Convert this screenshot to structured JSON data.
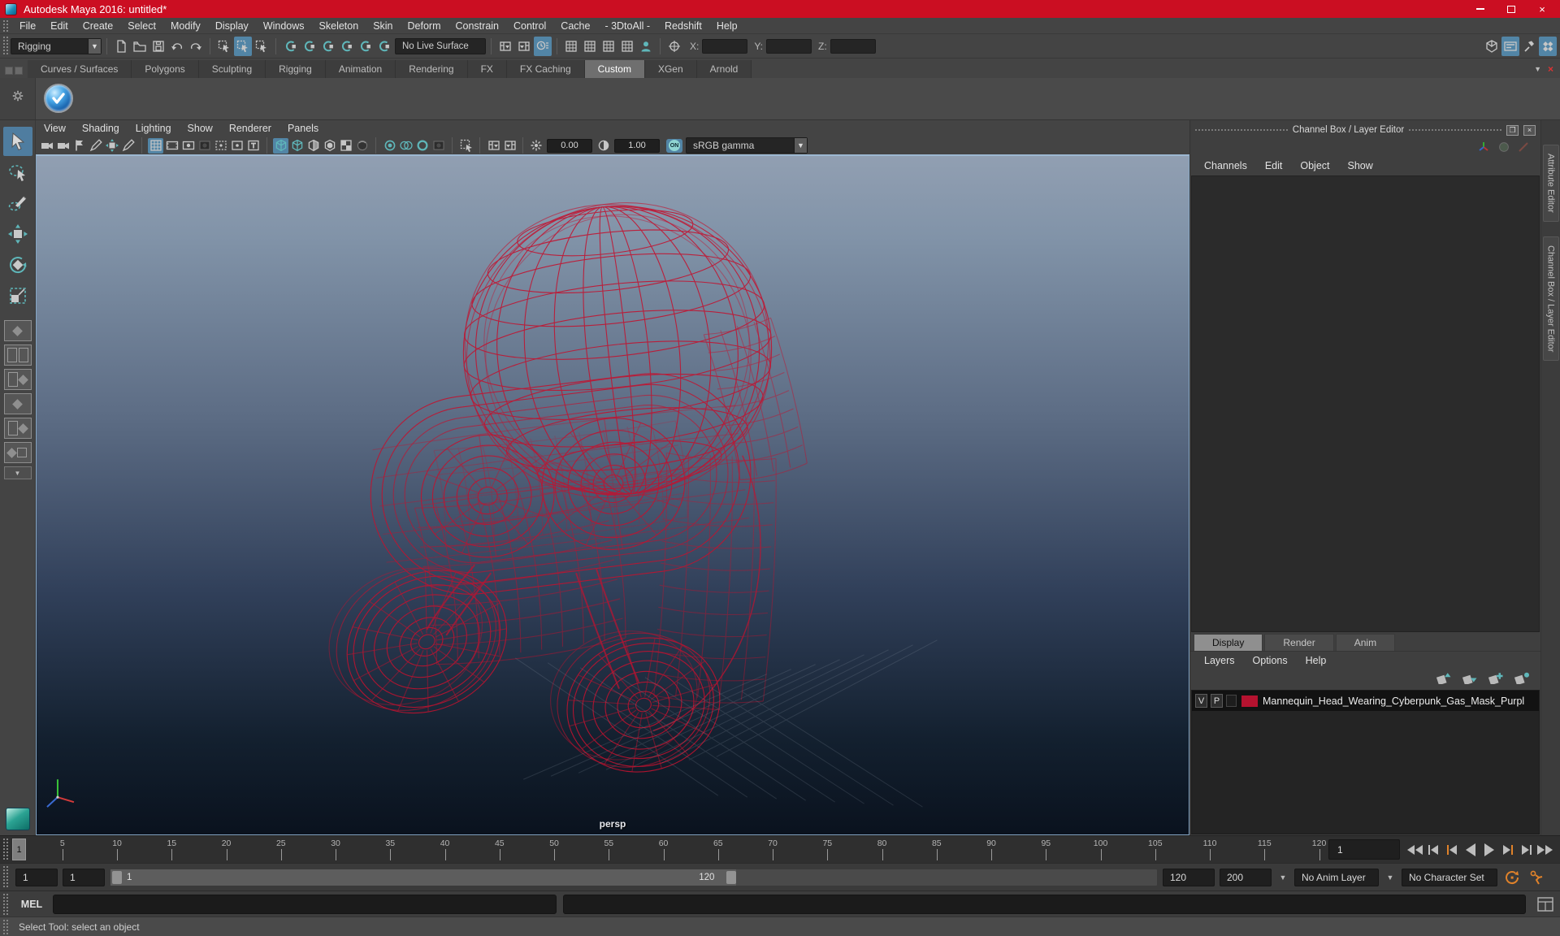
{
  "window": {
    "title": "Autodesk Maya 2016: untitled*",
    "controls": {
      "minimize": "minimize",
      "maximize": "maximize",
      "close": "×"
    }
  },
  "menu_bar": {
    "items": [
      "File",
      "Edit",
      "Create",
      "Select",
      "Modify",
      "Display",
      "Windows",
      "Skeleton",
      "Skin",
      "Deform",
      "Constrain",
      "Control",
      "Cache",
      "- 3DtoAll -",
      "Redshift",
      "Help"
    ]
  },
  "toolbar": {
    "menuset": "Rigging",
    "live_surface": "No Live Surface",
    "x_label": "X:",
    "y_label": "Y:",
    "z_label": "Z:",
    "icons_file": [
      "new-scene|page",
      "open-scene|folder",
      "save-scene|floppy",
      "undo|undo",
      "redo|redo"
    ],
    "icons_select": [
      "select-hierarchy|cursorbox",
      "select-object|cursorbox|a",
      "select-component|cursorbox"
    ],
    "icons_snap": [
      "snap-to-grids|magnet|t",
      "snap-to-curves|magnet|t",
      "snap-to-points|magnet|t",
      "snap-to-projected-center|magnet|t",
      "snap-to-view-planes|magnet|t",
      "make-live|magnet|t"
    ],
    "icons_history": [
      "input-connections|panel",
      "output-connections|panelr",
      "construction-history|clock|a"
    ],
    "icons_render": [
      "render-current-frame|grid2",
      "ipr-render|grid2",
      "render-settings|grid2",
      "paint-effects|grid2",
      "hypershade|person|t"
    ],
    "icons_right": [
      "modeling-toolkit|box3d",
      "attribute-editor-toggle|panelbars|a",
      "tool-settings-toggle|hammer",
      "channel-box-toggle|diamondgrid|a"
    ]
  },
  "shelf": {
    "tabs": [
      "Curves / Surfaces",
      "Polygons",
      "Sculpting",
      "Rigging",
      "Animation",
      "Rendering",
      "FX",
      "FX Caching",
      "Custom",
      "XGen",
      "Arnold"
    ],
    "active_tab": "Custom",
    "item": "custom-shelf-checkmark-tool"
  },
  "panel_menu": {
    "items": [
      "View",
      "Shading",
      "Lighting",
      "Show",
      "Renderer",
      "Panels"
    ]
  },
  "viewport": {
    "icons": [
      "select-camera|camera",
      "camera-attributes|camera",
      "camera-bookmark|flag",
      "image-plane|pencil",
      "2d-pan-zoom|move",
      "snap-pencil|pencil",
      "sep",
      "grid-display|grid|a",
      "film-gate|gate",
      "resolution-gate|gatedot",
      "gate-mask|darkpane",
      "display-region|region",
      "safe-action|pane",
      "field-chart|tletter",
      "sep",
      "wireframe-mode|cube|a t",
      "smooth-shade|cube|t",
      "wireframe-on-shaded|halfcube",
      "textured-mode|spherecube",
      "use-all-lights|checker",
      "shadows|darksphere",
      "sep",
      "screen-space-ao|aosphere|t",
      "motion-blur|circles|t",
      "multisample-aa|ring|t",
      "depth-of-field|darkpane",
      "sep",
      "isolate-select|isolate",
      "sep",
      "pane-layout-a|panel",
      "pane-layout-b|panelr"
    ],
    "exposure": "0.00",
    "contrast": "1.00",
    "gamma_on_label": "ON",
    "gamma": "sRGB gamma",
    "camera_label": "persp"
  },
  "dock": {
    "title": "Channel Box / Layer Editor",
    "header_icons": [
      "float-panel",
      "close-panel"
    ],
    "mini_icons": [
      "manip-axis",
      "manip-sphere",
      "manip-slash"
    ],
    "menus": [
      "Channels",
      "Edit",
      "Object",
      "Show"
    ],
    "side_tabs": [
      "Attribute Editor",
      "Channel Box / Layer Editor"
    ]
  },
  "layer_editor": {
    "tabs": [
      "Display",
      "Render",
      "Anim"
    ],
    "active_tab": "Display",
    "menus": [
      "Layers",
      "Options",
      "Help"
    ],
    "icons": [
      "move-layer-up",
      "move-layer-down",
      "create-empty-layer",
      "create-layer-from-selected"
    ],
    "layer": {
      "visible": "V",
      "playback": "P",
      "color": "#b5122f",
      "name": "Mannequin_Head_Wearing_Cyberpunk_Gas_Mask_Purpl"
    }
  },
  "timeline": {
    "current_frame": "1",
    "ticks": [
      5,
      10,
      15,
      20,
      25,
      30,
      35,
      40,
      45,
      50,
      55,
      60,
      65,
      70,
      75,
      80,
      85,
      90,
      95,
      100,
      105,
      110,
      115,
      120
    ],
    "frame_field": "1",
    "transport": [
      "go-to-start",
      "step-back-frame",
      "step-back-key",
      "play-backwards",
      "play-forwards",
      "step-forward-key",
      "step-forward-frame",
      "go-to-end"
    ]
  },
  "range_slider": {
    "anim_start": "1",
    "playback_start": "1",
    "handle_start_label": "1",
    "handle_end_label": "120",
    "playback_end": "120",
    "anim_end": "200",
    "anim_layer": "No Anim Layer",
    "character_set": "No Character Set",
    "icons": [
      "auto-keyframe",
      "animation-preferences"
    ]
  },
  "command_line": {
    "label": "MEL"
  },
  "help_line": {
    "text": "Select Tool: select an object"
  },
  "colors": {
    "titlebar": "#cb0e22",
    "accent_blue": "#5285a6",
    "teal": "#5fb7ba",
    "orange": "#e0822a",
    "wireframe": "#c2122f",
    "layer_swatch": "#b5122f"
  }
}
